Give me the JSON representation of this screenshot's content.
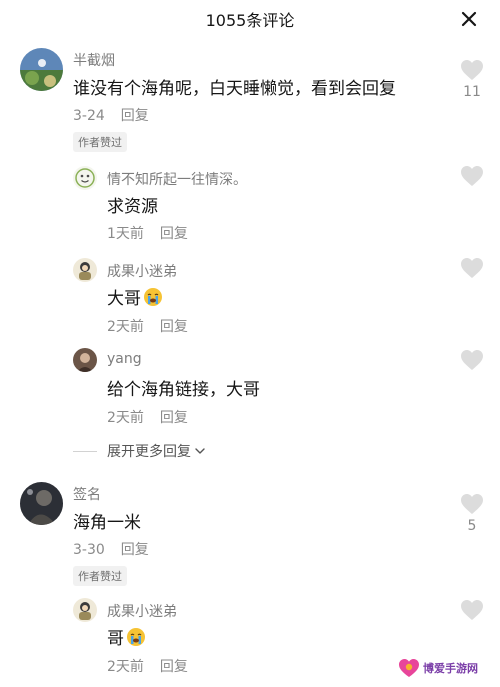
{
  "header": {
    "title": "1055条评论"
  },
  "comments": [
    {
      "username": "半截烟",
      "text": "谁没有个海角呢，白天睡懒觉，看到会回复",
      "date": "3-24",
      "reply_label": "回复",
      "badge": "作者赞过",
      "likes": "11"
    },
    {
      "username": "情不知所起一往情深。",
      "text": "求资源",
      "date": "1天前",
      "reply_label": "回复"
    },
    {
      "username": "成果小迷弟",
      "text": "大哥",
      "emoji": "crying-face",
      "date": "2天前",
      "reply_label": "回复"
    },
    {
      "username": "yang",
      "text": "给个海角链接，大哥",
      "date": "2天前",
      "reply_label": "回复"
    },
    {
      "username": "签名",
      "text": "海角一米",
      "date": "3-30",
      "reply_label": "回复",
      "badge": "作者赞过",
      "likes": "5"
    },
    {
      "username": "成果小迷弟",
      "text": "哥",
      "emoji": "crying-face",
      "date": "2天前",
      "reply_label": "回复"
    }
  ],
  "expand_replies": "展开更多回复",
  "watermark": {
    "text": "博爱手游网"
  },
  "colors": {
    "like_icon": "#dcdcdc",
    "meta_text": "#8a8a8a",
    "badge_bg": "#f1f1f1"
  }
}
